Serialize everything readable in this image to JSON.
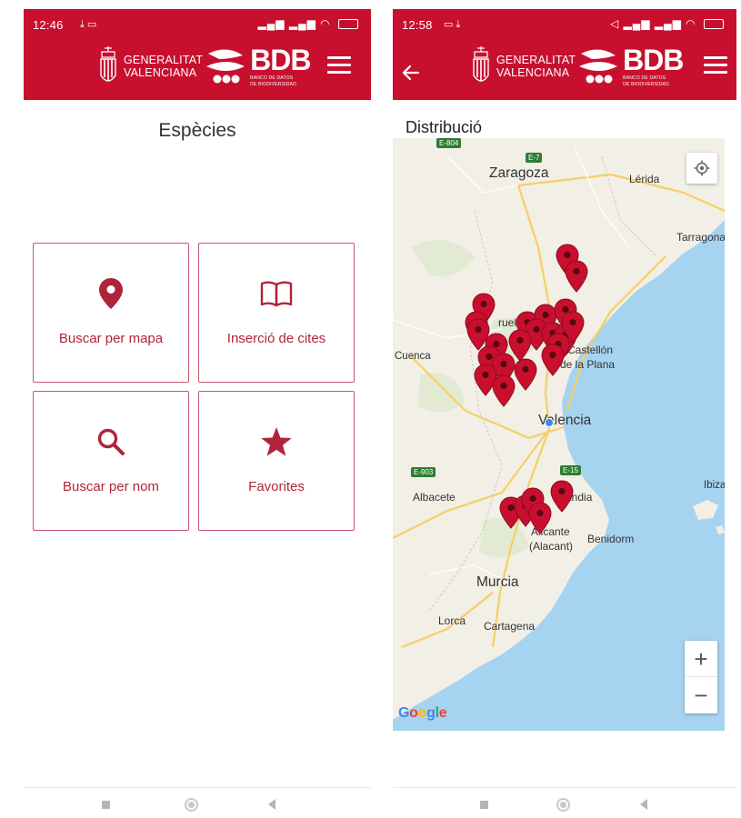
{
  "brand": {
    "primary_color": "#c8102e",
    "gv_line1": "GENERALITAT",
    "gv_line2": "VALENCIANA",
    "bdb": "BDB",
    "bdb_sub1": "BANCO DE DATOS",
    "bdb_sub2": "DE BIODIVERSIDAD"
  },
  "left_screen": {
    "status_time": "12:46",
    "page_title": "Espècies",
    "cards": {
      "map": {
        "label": "Buscar per mapa",
        "icon": "map-pin-icon"
      },
      "cites": {
        "label": "Inserció de cites",
        "icon": "book-open-icon"
      },
      "name": {
        "label": "Buscar per nom",
        "icon": "search-icon"
      },
      "favorites": {
        "label": "Favorites",
        "icon": "star-icon"
      }
    }
  },
  "right_screen": {
    "status_time": "12:58",
    "section_title": "Distribució",
    "map": {
      "cities": {
        "zaragoza": "Zaragoza",
        "lerida": "Lérida",
        "tarragona": "Tarragona",
        "teruel": "ruel",
        "cuenca": "Cuenca",
        "castellon_1": "Castellón",
        "castellon_2": "de la Plana",
        "valencia": "Valencia",
        "albacete": "Albacete",
        "gandia": "andia",
        "ibiza": "Ibiza",
        "alicante_1": "Alicante",
        "alicante_2": "(Alacant)",
        "benidorm": "Benidorm",
        "murcia": "Murcia",
        "lorca": "Lorca",
        "cartagena": "Cartagena"
      },
      "road_badges": {
        "e804": "E-804",
        "e7": "E-7",
        "e903": "E-903",
        "e15": "E-15"
      },
      "attribution": "Google",
      "zoom_in": "+",
      "zoom_out": "−",
      "marker_color": "#c8102e",
      "sea_color": "#a6d3f0",
      "land_color": "#f2efe6",
      "location_dot_color": "#4285f4"
    }
  }
}
